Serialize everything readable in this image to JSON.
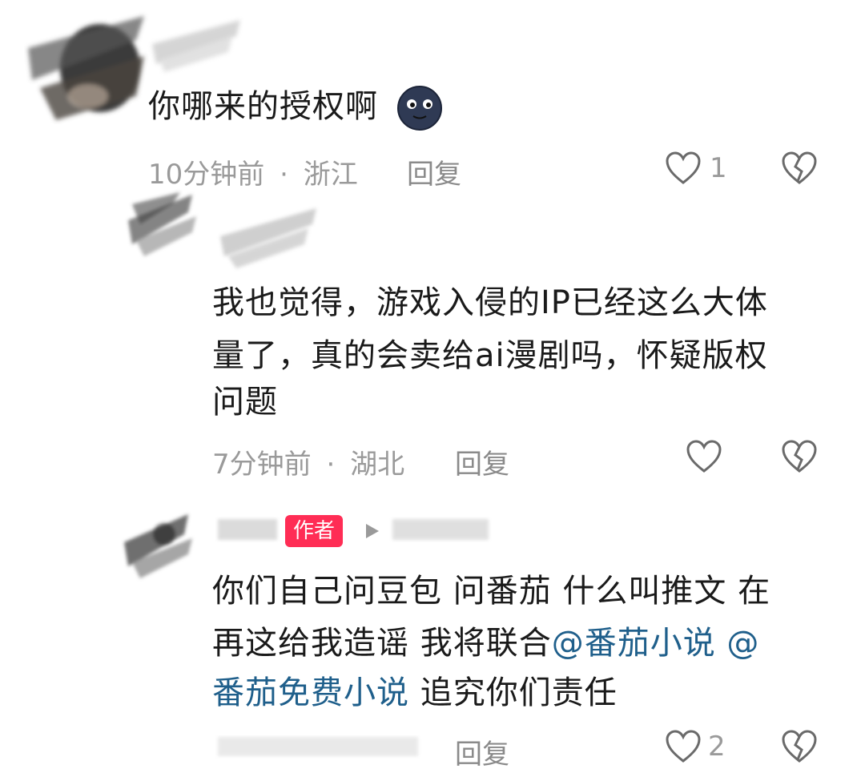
{
  "comments": [
    {
      "text": "你哪来的授权啊",
      "emoji": "new-moon-face-icon",
      "time": "10分钟前",
      "separator": "·",
      "location": "浙江",
      "reply_label": "回复",
      "like_count": "1"
    },
    {
      "text_line1": "我也觉得，游戏入侵的IP已经这么大体",
      "text_line2": "量了，真的会卖给ai漫剧吗，怀疑版权",
      "text_line3": "问题",
      "time": "7分钟前",
      "separator": "·",
      "location": "湖北",
      "reply_label": "回复",
      "like_count": ""
    },
    {
      "author_badge": "作者",
      "text_line1": "你们自己问豆包  问番茄 什么叫推文 在",
      "text_line2_a": "再这给我造谣 我将联合",
      "mention1": "@番茄小说 @",
      "mention2": "番茄免费小说",
      "text_line3_b": " 追究你们责任",
      "reply_label": "回复",
      "like_count": "2"
    }
  ],
  "colors": {
    "badge": "#ff2d55",
    "mention": "#1f5f8b",
    "meta": "#9a9a9a"
  }
}
